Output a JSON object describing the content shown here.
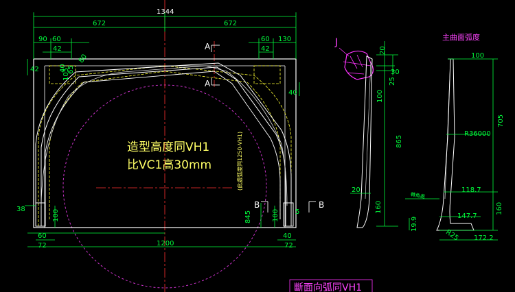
{
  "colors": {
    "background": "#000000",
    "dimension": "#00ff3c",
    "outline": "#ffffff",
    "hidden": "#ffff33",
    "centerline": "#ff3030",
    "circle": "#cc33cc",
    "detail": "#ff33ff",
    "cyan": "#00ffff"
  },
  "top_dims": {
    "total": "1344",
    "left_half": "672",
    "right_half": "672",
    "d90": "90",
    "d60_left": "60",
    "d42_left": "42",
    "d60_right": "60",
    "d130": "130",
    "d42_right": "42"
  },
  "side_dims": {
    "d42": "42",
    "d65": "65",
    "d40": "40",
    "d105": "105",
    "d80": "80",
    "d40_right": "40",
    "d38": "38",
    "d100_left": "100",
    "d100_right": "100",
    "d845": "845",
    "d5": "5"
  },
  "bottom_dims": {
    "d60": "60",
    "d72_left": "72",
    "d1200": "1200",
    "d40": "40",
    "d72_right": "72"
  },
  "section_marks": {
    "a_top": "A",
    "a_bottom": "A",
    "b_left": "B",
    "b_right": "B"
  },
  "notes": {
    "line1": "造型高度同VH1",
    "line2": "比VC1高30mm",
    "vertical_note": "(此處弧度同1250-VH1)"
  },
  "detail": {
    "label": "J",
    "d20_top": "20",
    "d30": "30",
    "d25": "25",
    "d100": "100",
    "d865": "865",
    "d20_bottom": "20",
    "d160": "160"
  },
  "profile": {
    "title": "主曲面弧度",
    "d100": "100",
    "d705": "705",
    "radius": "R36000",
    "d118_7": "118.7",
    "d160": "160",
    "d147_7": "147.7",
    "d19_9": "19.9",
    "r25": "R25",
    "d172_2": "172.2",
    "small_note": "轉角處"
  },
  "section_title": "斷面向弧同VH1"
}
